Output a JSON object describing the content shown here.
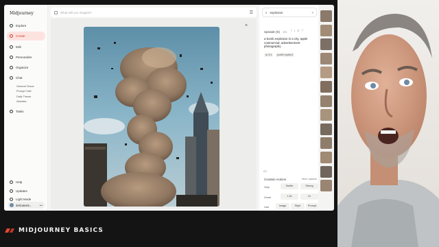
{
  "app": {
    "title": "Midjourney"
  },
  "sidebar": {
    "items": [
      {
        "label": "Explore",
        "icon": "compass-icon"
      },
      {
        "label": "Create",
        "icon": "brush-icon"
      },
      {
        "label": "Edit",
        "icon": "edit-icon"
      },
      {
        "label": "Personalize",
        "icon": "person-icon"
      },
      {
        "label": "Organize",
        "icon": "folder-icon"
      },
      {
        "label": "Chat",
        "icon": "chat-icon"
      }
    ],
    "chat_rooms": [
      "General Chaos",
      "Prompt Craft",
      "Daily Theme",
      "Newbies"
    ],
    "tasks": "Tasks",
    "bottom": [
      "Help",
      "Updates",
      "Light Mode"
    ],
    "user": "delicateste..."
  },
  "search": {
    "placeholder": "What will you imagine?"
  },
  "right_panel": {
    "search_value": "explosion",
    "upscale_label": "Upscale (S)",
    "upscale_time": "1m",
    "prompt": "a bomb explosion in a city, apple commercial, advertisement photography",
    "tags": [
      "ar 3:4",
      "profile kxyfbn3"
    ],
    "creation_actions": "Creation Actions",
    "more_options": "More options",
    "rows": [
      {
        "label": "Vary",
        "buttons": [
          "Subtle",
          "Strong"
        ]
      },
      {
        "label": "Zoom",
        "buttons": [
          "1.5x",
          "2x"
        ]
      },
      {
        "label": "Use",
        "buttons": [
          "Image",
          "Style",
          "Prompt"
        ]
      }
    ]
  },
  "banner": {
    "text": "MIDJOURNEY BASICS"
  },
  "colors": {
    "accent": "#d23a2a",
    "banner_logo": "#e8462f"
  }
}
